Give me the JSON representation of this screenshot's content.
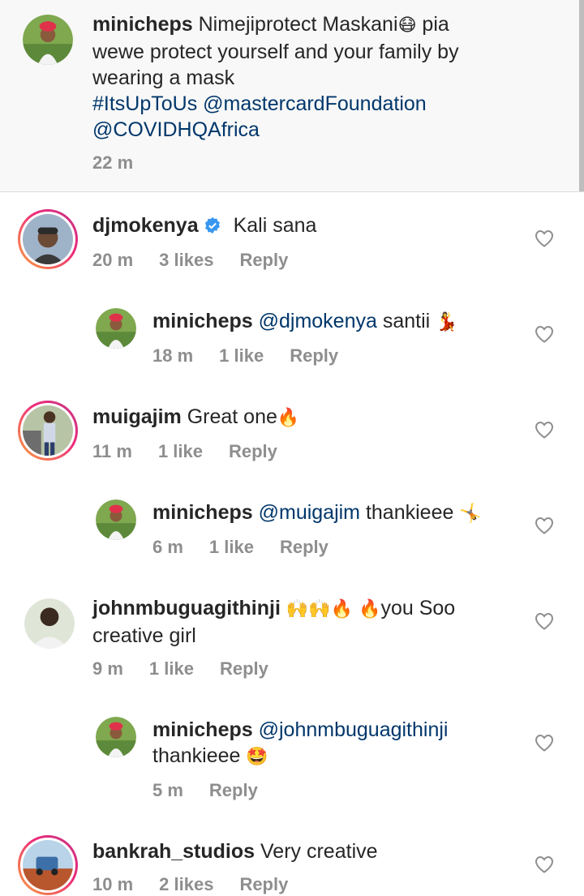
{
  "caption": {
    "username": "minicheps",
    "text_line1": "Nimejiprotect Maskani",
    "emoji1": "😷",
    "text_line1b": " pia",
    "text_line2": "wewe protect yourself and your family by",
    "text_line3": "wearing a mask",
    "hashtag": "#ItsUpToUs",
    "mention1": "@mastercardFoundation",
    "mention2": "@COVIDHQAfrica",
    "time": "22 m"
  },
  "comments": [
    {
      "username": "djmokenya",
      "verified": true,
      "text": "Kali sana",
      "time": "20 m",
      "likes": "3 likes",
      "reply": "Reply"
    },
    {
      "username": "minicheps",
      "mention": "@djmokenya",
      "text": " santii",
      "emoji": "💃",
      "time": "18 m",
      "likes": "1 like",
      "reply": "Reply"
    },
    {
      "username": "muigajim",
      "text": "Great one",
      "emoji": "🔥",
      "time": "11 m",
      "likes": "1 like",
      "reply": "Reply"
    },
    {
      "username": "minicheps",
      "mention": "@muigajim",
      "text": " thankieee",
      "emoji": "🤸",
      "time": "6 m",
      "likes": "1 like",
      "reply": "Reply"
    },
    {
      "username": "johnmbuguagithinji",
      "emoji": "🙌🙌🔥 🔥",
      "text": "you Soo",
      "text2": "creative girl",
      "time": "9 m",
      "likes": "1 like",
      "reply": "Reply"
    },
    {
      "username": "minicheps",
      "mention": "@johnmbuguagithinji",
      "text2": "thankieee",
      "emoji": "🤩",
      "time": "5 m",
      "reply": "Reply"
    },
    {
      "username": "bankrah_studios",
      "text": "Very creative",
      "time": "10 m",
      "likes": "2 likes",
      "reply": "Reply"
    }
  ],
  "icons": {
    "heart": "heart-outline-icon",
    "verified": "verified-badge-icon"
  },
  "colors": {
    "mention": "#00376b",
    "meta": "#8e8e8e",
    "verified": "#3897f0"
  }
}
